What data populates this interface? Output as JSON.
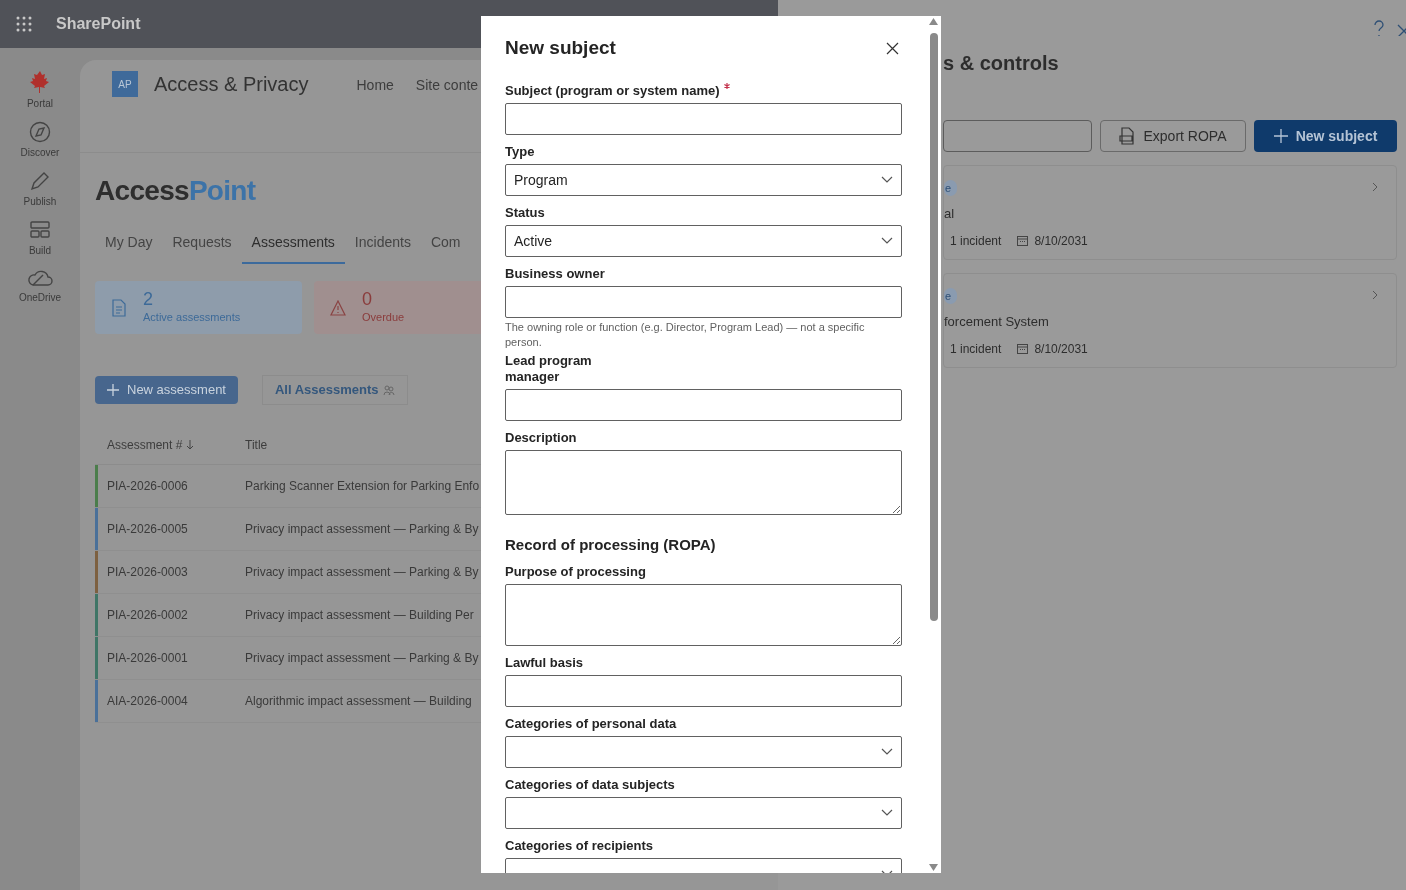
{
  "app_bar": {
    "title": "SharePoint"
  },
  "rail": [
    {
      "label": "Portal"
    },
    {
      "label": "Discover"
    },
    {
      "label": "Publish"
    },
    {
      "label": "Build"
    },
    {
      "label": "OneDrive"
    }
  ],
  "site": {
    "logo": "AP",
    "title": "Access & Privacy",
    "nav": [
      "Home",
      "Site conte"
    ]
  },
  "brand": {
    "first": "Access",
    "second": "Point"
  },
  "tabs": [
    {
      "label": "My Day",
      "selected": false
    },
    {
      "label": "Requests",
      "selected": false
    },
    {
      "label": "Assessments",
      "selected": true
    },
    {
      "label": "Incidents",
      "selected": false
    },
    {
      "label": "Com",
      "selected": false
    }
  ],
  "stats": [
    {
      "value": "2",
      "label": "Active assessments",
      "kind": "info"
    },
    {
      "value": "0",
      "label": "Overdue",
      "kind": "warning"
    }
  ],
  "new_assessment": "New assessment",
  "view": "All Assessments",
  "table": {
    "columns": [
      "Assessment #",
      "Title"
    ],
    "rows": [
      {
        "id": "PIA-2026-0006",
        "title": "Parking Scanner Extension for Parking Enfo",
        "color": "#4b7d4b"
      },
      {
        "id": "PIA-2026-0005",
        "title": "Privacy impact assessment — Parking & By",
        "color": "#4a7099"
      },
      {
        "id": "PIA-2026-0003",
        "title": "Privacy impact assessment — Parking & By",
        "color": "#7d6040"
      },
      {
        "id": "PIA-2026-0002",
        "title": "Privacy impact assessment — Building Per",
        "color": "#3f7566"
      },
      {
        "id": "PIA-2026-0001",
        "title": "Privacy impact assessment — Parking & By",
        "color": "#3f7566"
      },
      {
        "id": "AIA-2026-0004",
        "title": "Algorithmic impact assessment — Building",
        "color": "#4a7099"
      }
    ]
  },
  "panel": {
    "title": "s & controls",
    "export": "Export ROPA",
    "new": "New subject",
    "cards": [
      {
        "badge": "e",
        "name": "al",
        "incidents": "1 incident",
        "date": "8/10/2031"
      },
      {
        "badge": "e",
        "name": "forcement System",
        "incidents": "1 incident",
        "date": "8/10/2031"
      }
    ]
  },
  "dialog": {
    "title": "New subject",
    "fields": [
      {
        "kind": "text",
        "label": "Subject (program or system name)",
        "required": true
      },
      {
        "kind": "select",
        "label": "Type",
        "value": "Program",
        "required": false
      },
      {
        "kind": "select",
        "label": "Status",
        "value": "Active",
        "required": false
      },
      {
        "kind": "text",
        "label": "Business owner",
        "help": "The owning role or function (e.g. Director, Program Lead) — not a specific person.",
        "required": false
      },
      {
        "kind": "text",
        "label": "Lead program manager",
        "required": false
      },
      {
        "kind": "textarea",
        "label": "Description",
        "required": false
      },
      {
        "kind": "heading",
        "label": "Record of processing (ROPA)"
      },
      {
        "kind": "textarea",
        "label": "Purpose of processing",
        "required": false
      },
      {
        "kind": "text",
        "label": "Lawful basis",
        "required": false
      },
      {
        "kind": "select",
        "label": "Categories of personal data",
        "required": false
      },
      {
        "kind": "select",
        "label": "Categories of data subjects",
        "required": false
      },
      {
        "kind": "select",
        "label": "Categories of recipients",
        "required": false
      }
    ]
  }
}
